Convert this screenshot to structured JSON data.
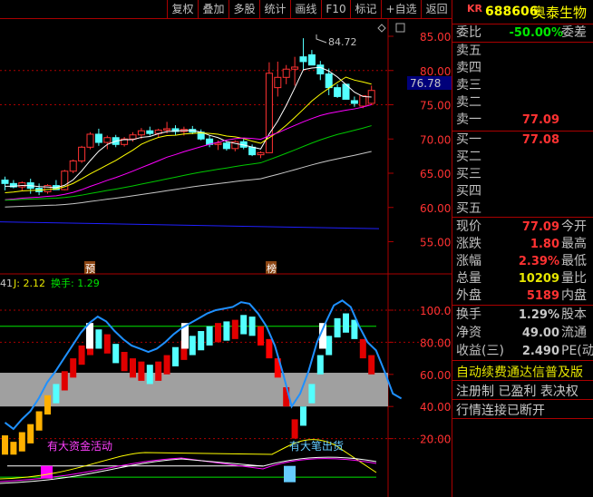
{
  "toolbar": {
    "items": [
      "复权",
      "叠加",
      "多股",
      "统计",
      "画线",
      "F10",
      "标记",
      "+自选",
      "返回"
    ]
  },
  "quote": {
    "prefix": "KR",
    "code": "688606",
    "name": "奥泰生物",
    "weibi_label": "委比",
    "weibi_value": "-50.00%",
    "weicha_label": "委差",
    "sell": [
      {
        "label": "卖五",
        "price": ""
      },
      {
        "label": "卖四",
        "price": ""
      },
      {
        "label": "卖三",
        "price": ""
      },
      {
        "label": "卖二",
        "price": ""
      },
      {
        "label": "卖一",
        "price": "77.09"
      }
    ],
    "buy": [
      {
        "label": "买一",
        "price": "77.08"
      },
      {
        "label": "买二",
        "price": ""
      },
      {
        "label": "买三",
        "price": ""
      },
      {
        "label": "买四",
        "price": ""
      },
      {
        "label": "买五",
        "price": ""
      }
    ],
    "stats": [
      {
        "label": "现价",
        "value": "77.09",
        "right": "今开",
        "color": "#ff3232"
      },
      {
        "label": "涨跌",
        "value": "1.80",
        "right": "最高",
        "color": "#ff3232"
      },
      {
        "label": "涨幅",
        "value": "2.39%",
        "right": "最低",
        "color": "#ff3232"
      },
      {
        "label": "总量",
        "value": "10209",
        "right": "量比",
        "color": "#e6e600"
      },
      {
        "label": "外盘",
        "value": "5189",
        "right": "内盘",
        "color": "#ff3232"
      }
    ],
    "stats2": [
      {
        "label": "换手",
        "value": "1.29%",
        "right": "股本"
      },
      {
        "label": "净资",
        "value": "49.00",
        "right": "流通"
      },
      {
        "label": "收益(三)",
        "value": "2.490",
        "right": "PE(动"
      }
    ],
    "banner": "自动续费通达信普及版",
    "tags": "注册制 已盈利 表决权",
    "status": "行情连接已断开"
  },
  "chart": {
    "current_price_label": "76.78",
    "high_label": "84.72",
    "price_ticks": [
      "85.00",
      "80.00",
      "75.00",
      "70.00",
      "65.00",
      "60.00",
      "55.00"
    ],
    "markers": [
      "预",
      "榜"
    ],
    "indicator_header": {
      "prefix": "41",
      "j_label": "J: 2.12",
      "turnover_label": "换手: 1.29"
    },
    "indicator_ticks": [
      "100.00",
      "80.00",
      "60.00",
      "40.00",
      "20.00"
    ],
    "annotations": [
      "有大资金活动",
      "有大笔出货"
    ]
  },
  "chart_data": {
    "type": "candlestick",
    "ohlc": [
      [
        64,
        64.5,
        62.5,
        63.5
      ],
      [
        63.5,
        64,
        62.8,
        63
      ],
      [
        63,
        63.8,
        62.5,
        63.6
      ],
      [
        63.6,
        64.2,
        62,
        62.8
      ],
      [
        62.8,
        63.5,
        61.8,
        62.3
      ],
      [
        62.3,
        63.4,
        62,
        63.2
      ],
      [
        63.2,
        64,
        62.8,
        62.6
      ],
      [
        62.6,
        65.5,
        62.5,
        65.3
      ],
      [
        65.3,
        67,
        65,
        66.8
      ],
      [
        66.8,
        69,
        66.5,
        68.8
      ],
      [
        68.8,
        71,
        68.5,
        70.7
      ],
      [
        70.7,
        71.5,
        69,
        69.5
      ],
      [
        69.5,
        70.5,
        68.5,
        70.2
      ],
      [
        70.2,
        70.6,
        68.8,
        69.2
      ],
      [
        69.2,
        70.3,
        68.9,
        70
      ],
      [
        70,
        71,
        69.6,
        70.6
      ],
      [
        70.6,
        71.6,
        70,
        71.2
      ],
      [
        71.2,
        71.8,
        70.5,
        70.8
      ],
      [
        70.8,
        71.5,
        70.2,
        71.3
      ],
      [
        71.3,
        72.5,
        70.8,
        71.5
      ],
      [
        71.5,
        72,
        70.6,
        71.1
      ],
      [
        71.1,
        71.8,
        70.5,
        71.4
      ],
      [
        71.4,
        71.9,
        70.7,
        71
      ],
      [
        71,
        71.4,
        69.8,
        70
      ],
      [
        70,
        70.5,
        68.8,
        69.2
      ],
      [
        69.2,
        69.8,
        68.4,
        69.4
      ],
      [
        69.4,
        69.6,
        68.3,
        68.6
      ],
      [
        68.6,
        69.8,
        68.2,
        69.6
      ],
      [
        69.6,
        70,
        68.5,
        68.8
      ],
      [
        68.8,
        69.2,
        67.5,
        67.7
      ],
      [
        67.7,
        68.2,
        67.2,
        68
      ],
      [
        68,
        81.2,
        68,
        79.6
      ],
      [
        77.5,
        81.3,
        76.2,
        79
      ],
      [
        79,
        80.8,
        78,
        80.2
      ],
      [
        80.2,
        82,
        77.8,
        80.5
      ],
      [
        82,
        84.72,
        80,
        81.3
      ],
      [
        82.3,
        83,
        80.8,
        80.8
      ],
      [
        80.8,
        81.4,
        78.6,
        79.5
      ],
      [
        79.5,
        80.3,
        76.4,
        77.5
      ],
      [
        77.5,
        78,
        76,
        76.2
      ],
      [
        78,
        78,
        75.8,
        75.8
      ],
      [
        75.6,
        76.2,
        74.7,
        75.2
      ],
      [
        74.8,
        76,
        74.5,
        76.3
      ],
      [
        75.2,
        77.8,
        75,
        77.09
      ]
    ],
    "indicator": {
      "blue_line": [
        30,
        26,
        32,
        37,
        45,
        55,
        62,
        70,
        78,
        86,
        92,
        96,
        93,
        87,
        82,
        78,
        76,
        74,
        76,
        80,
        85,
        89,
        92,
        95,
        98,
        100,
        101,
        102,
        105,
        104,
        98,
        90,
        78,
        60,
        40,
        48,
        62,
        80,
        92,
        103,
        106,
        102,
        90,
        80,
        75,
        62,
        48,
        45
      ]
    }
  }
}
